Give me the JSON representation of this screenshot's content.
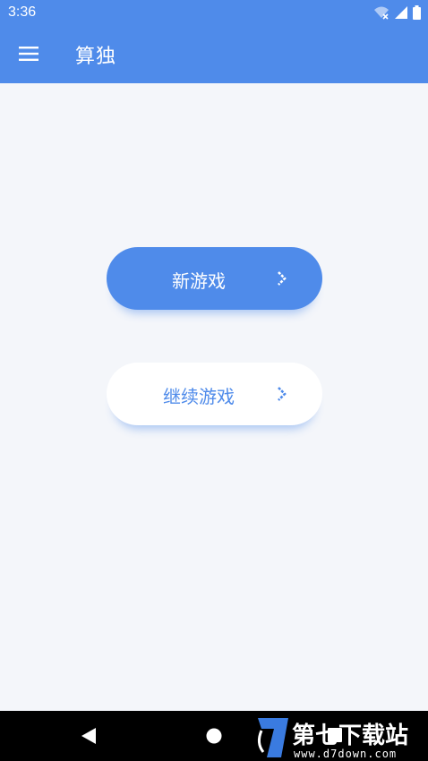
{
  "status_bar": {
    "time": "3:36",
    "icons": [
      "wifi-off-icon",
      "signal-icon",
      "battery-icon"
    ]
  },
  "app_bar": {
    "title": "算独",
    "menu_icon": "hamburger-menu-icon",
    "color": "#4f8bea"
  },
  "main": {
    "new_game_label": "新游戏",
    "continue_game_label": "继续游戏",
    "chevron_icon": "chevron-right-icon"
  },
  "nav_bar": {
    "buttons": [
      "back-icon",
      "home-icon",
      "recents-icon"
    ]
  },
  "watermark": {
    "text": "第七下载站",
    "url": "www.d7down.com"
  },
  "colors": {
    "accent": "#4f8bea",
    "background": "#f4f6fa"
  }
}
